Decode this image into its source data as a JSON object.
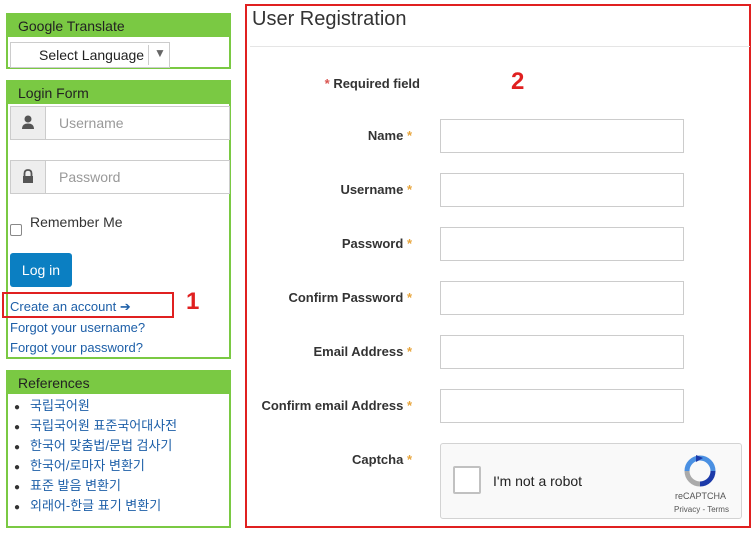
{
  "translate": {
    "title": "Google Translate",
    "select_label": "Select Language",
    "arrow": "▼"
  },
  "login": {
    "title": "Login Form",
    "username_placeholder": "Username",
    "password_placeholder": "Password",
    "remember_label": "Remember Me",
    "login_button": "Log in",
    "create_account": "Create an account ➔",
    "forgot_username": "Forgot your username?",
    "forgot_password": "Forgot your password?",
    "annotation": "1"
  },
  "references": {
    "title": "References",
    "items": [
      "국립국어원",
      "국립국어원 표준국어대사전",
      "한국어 맞춤법/문법 검사기",
      "한국어/로마자 변환기",
      "표준 발음 변환기",
      "외래어-한글 표기 변환기"
    ]
  },
  "registration": {
    "title": "User Registration",
    "required_note": "Required field",
    "annotation": "2",
    "fields": {
      "name": "Name",
      "username": "Username",
      "password": "Password",
      "confirm_password": "Confirm Password",
      "email": "Email Address",
      "confirm_email": "Confirm email Address",
      "captcha": "Captcha"
    },
    "star": "*"
  },
  "captcha": {
    "label": "I'm not a robot",
    "brand": "reCAPTCHA",
    "terms": "Privacy - Terms"
  },
  "colors": {
    "panel_green": "#7ac943",
    "button_blue": "#0b7fc2",
    "link_blue": "#1d5fa8",
    "annotation_red": "#e02020"
  }
}
